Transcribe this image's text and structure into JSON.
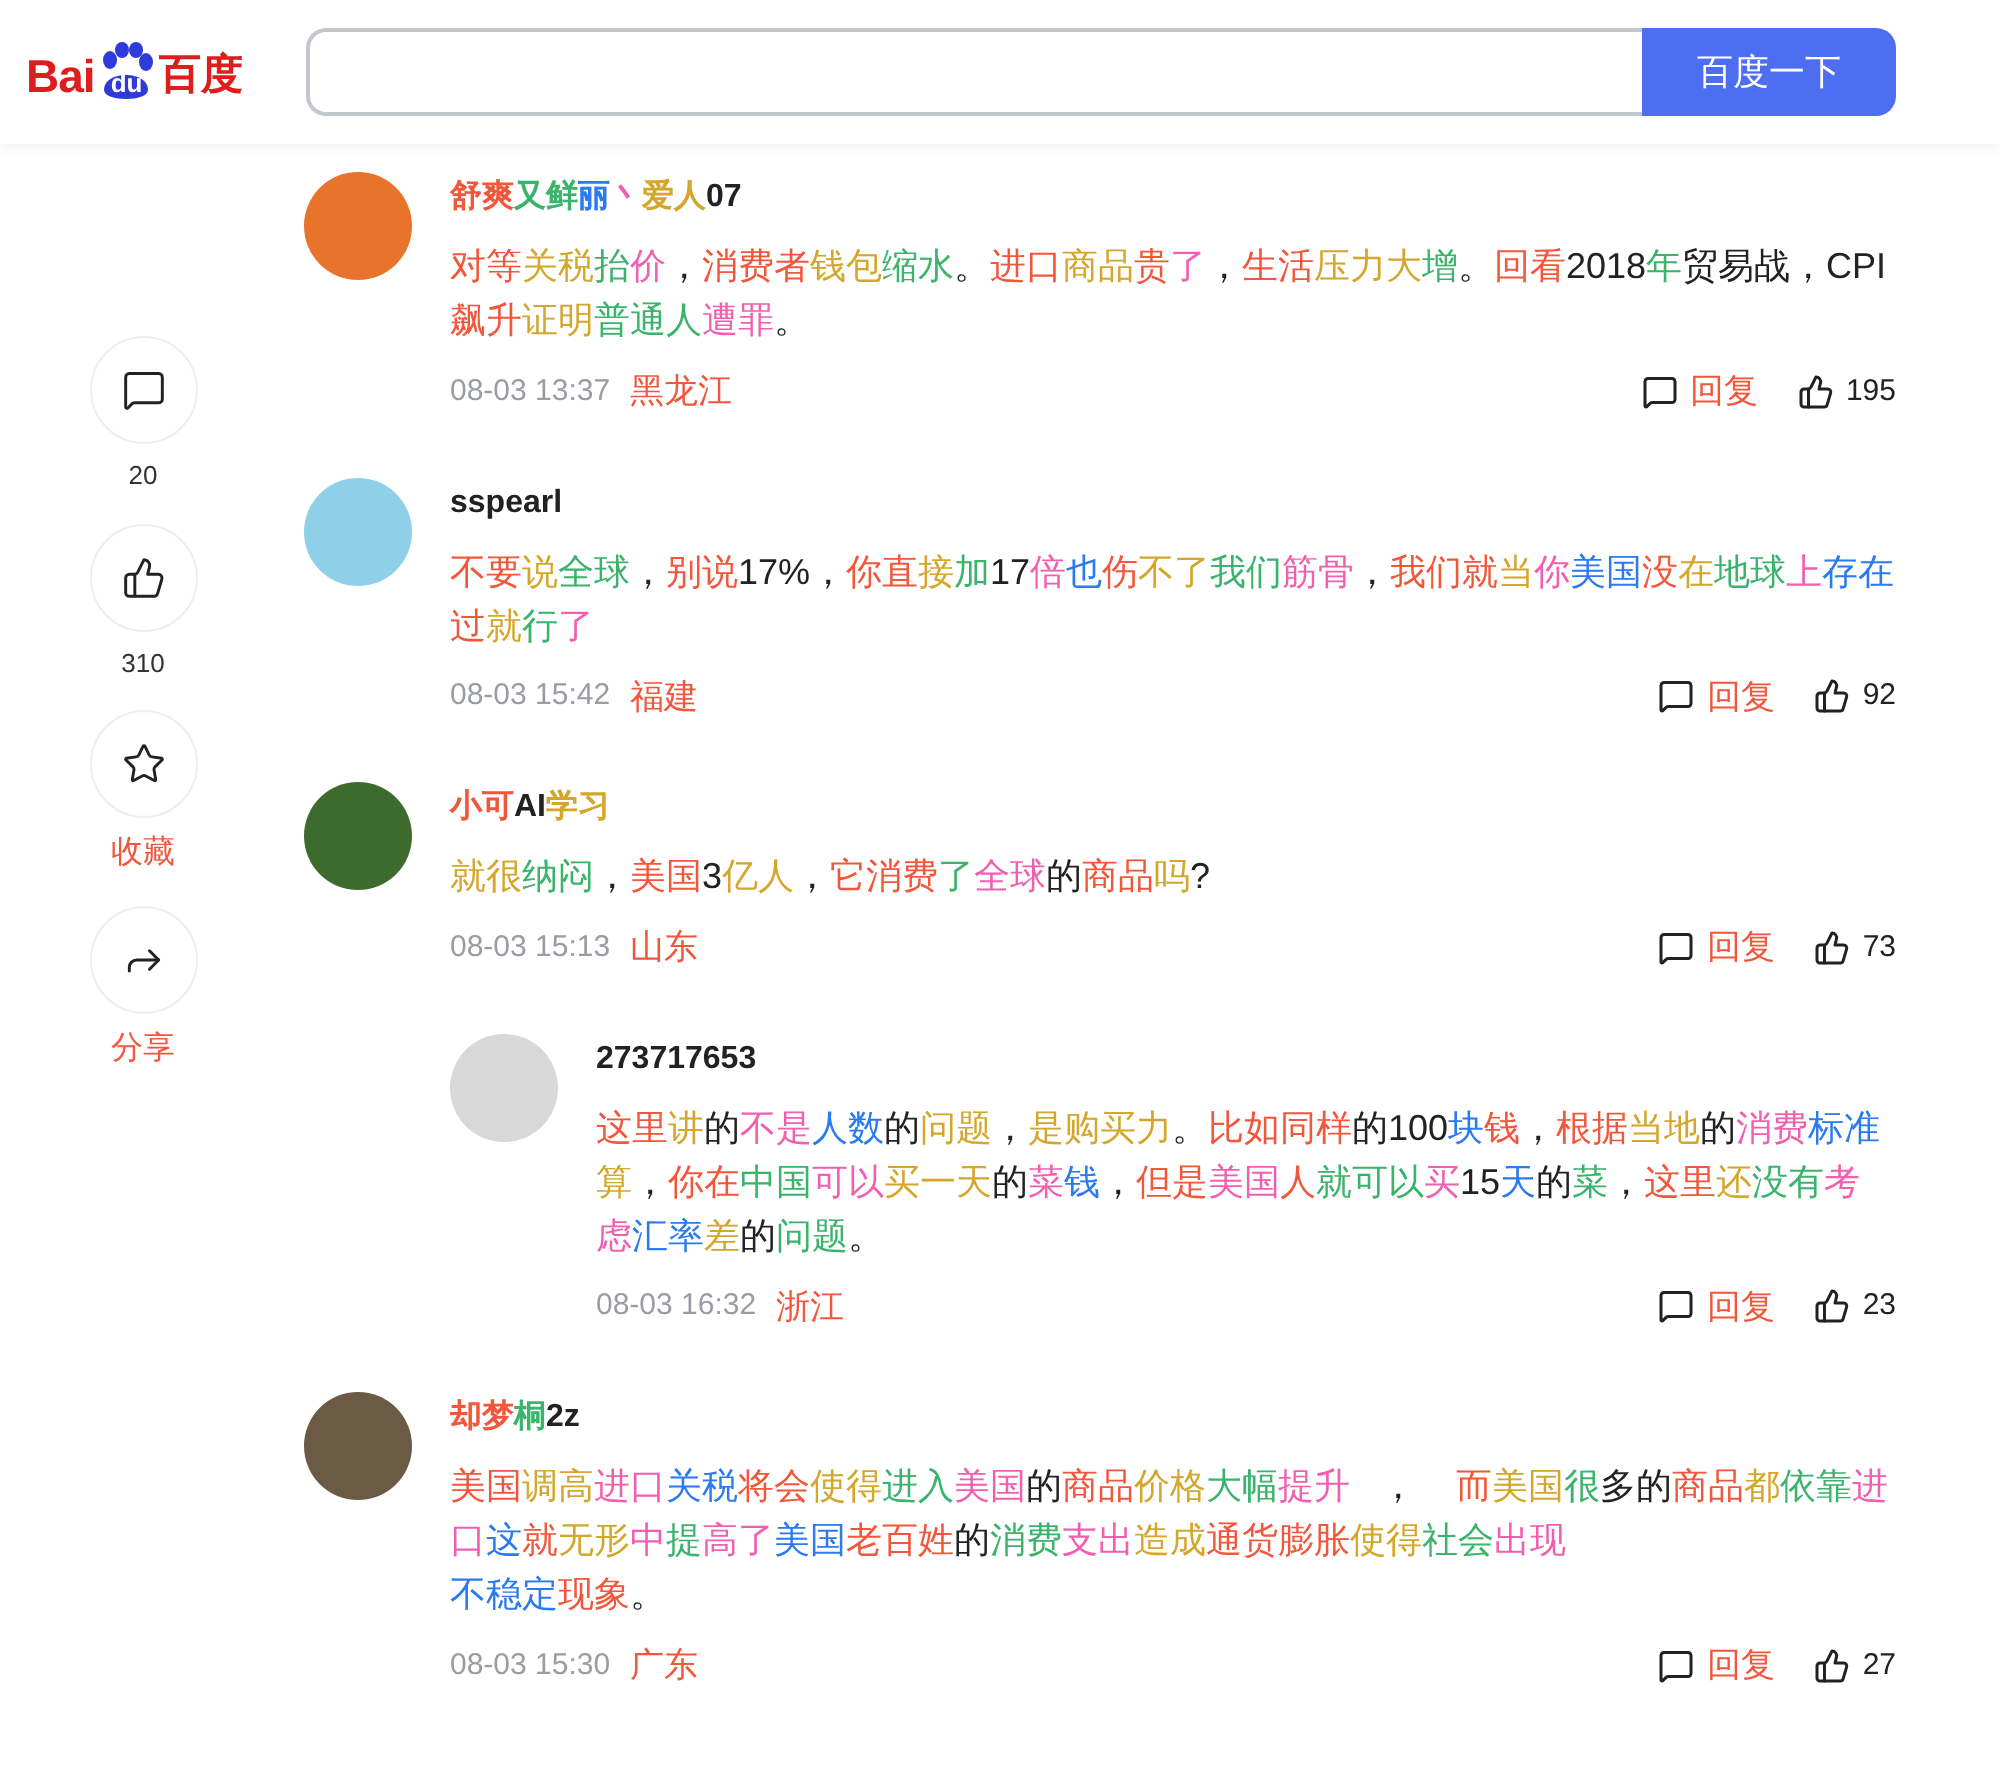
{
  "logo": {
    "left": "Bai",
    "paw": "du",
    "right": "百度"
  },
  "search": {
    "button": "百度一下"
  },
  "sidebar": [
    {
      "kind": "comment",
      "label": "20"
    },
    {
      "kind": "like",
      "label": "310"
    },
    {
      "kind": "star",
      "label": "收藏"
    },
    {
      "kind": "share",
      "label": "分享"
    }
  ],
  "comments": [
    {
      "user": [
        {
          "text": "舒爽",
          "color": "#f2573c"
        },
        {
          "text": "又鲜",
          "color": "#3ab36b"
        },
        {
          "text": "丽",
          "color": "#2b7bf0"
        },
        {
          "text": "丶",
          "color": "#f25fb0"
        },
        {
          "text": "爱人",
          "color": "#d4a72c"
        },
        {
          "text": "07",
          "color": "#222222"
        }
      ],
      "text": [
        {
          "text": "对等",
          "color": "#f2573c"
        },
        {
          "text": "关税",
          "color": "#d4a72c"
        },
        {
          "text": "抬",
          "color": "#3ab36b"
        },
        {
          "text": "价",
          "color": "#f25fb0"
        },
        {
          "text": "，",
          "color": "#222222"
        },
        {
          "text": "消费者",
          "color": "#f2573c"
        },
        {
          "text": "钱包",
          "color": "#d4a72c"
        },
        {
          "text": "缩水",
          "color": "#3ab36b"
        },
        {
          "text": "。",
          "color": "#222222"
        },
        {
          "text": "进口",
          "color": "#f2573c"
        },
        {
          "text": "商品",
          "color": "#d4a72c"
        },
        {
          "text": "贵",
          "color": "#f2573c"
        },
        {
          "text": "了",
          "color": "#f25fb0"
        },
        {
          "text": "，",
          "color": "#222222"
        },
        {
          "text": "生活",
          "color": "#f2573c"
        },
        {
          "text": "压力大",
          "color": "#d4a72c"
        },
        {
          "text": "增",
          "color": "#3ab36b"
        },
        {
          "text": "。",
          "color": "#222222"
        },
        {
          "text": "回看",
          "color": "#f2573c"
        },
        {
          "text": "2018",
          "color": "#222222"
        },
        {
          "text": "年",
          "color": "#3ab36b"
        },
        {
          "text": "贸易战，CPI",
          "color": "#222222"
        },
        {
          "text": "飙升",
          "color": "#f2573c"
        },
        {
          "text": "证明",
          "color": "#d4a72c"
        },
        {
          "text": "普通人",
          "color": "#3ab36b"
        },
        {
          "text": "遭罪",
          "color": "#f25fb0"
        },
        {
          "text": "。",
          "color": "#222222"
        }
      ],
      "time": "08-03 13:37",
      "location": "黑龙江",
      "reply": "回复",
      "likes": "195"
    },
    {
      "user": [
        {
          "text": "sspearl",
          "color": "#222222"
        }
      ],
      "text": [
        {
          "text": "不要",
          "color": "#f2573c"
        },
        {
          "text": "说",
          "color": "#d4a72c"
        },
        {
          "text": "全球",
          "color": "#3ab36b"
        },
        {
          "text": "，",
          "color": "#222222"
        },
        {
          "text": "别说",
          "color": "#f2573c"
        },
        {
          "text": "17%，",
          "color": "#222222"
        },
        {
          "text": "你直",
          "color": "#f2573c"
        },
        {
          "text": "接",
          "color": "#d4a72c"
        },
        {
          "text": "加",
          "color": "#3ab36b"
        },
        {
          "text": "17",
          "color": "#222222"
        },
        {
          "text": "倍",
          "color": "#f25fb0"
        },
        {
          "text": "也",
          "color": "#2b7bf0"
        },
        {
          "text": "伤",
          "color": "#f2573c"
        },
        {
          "text": "不了",
          "color": "#d4a72c"
        },
        {
          "text": "我们",
          "color": "#3ab36b"
        },
        {
          "text": "筋骨",
          "color": "#f25fb0"
        },
        {
          "text": "，",
          "color": "#222222"
        },
        {
          "text": "我们就",
          "color": "#f2573c"
        },
        {
          "text": "当",
          "color": "#d4a72c"
        },
        {
          "text": "你",
          "color": "#f25fb0"
        },
        {
          "text": "美国",
          "color": "#2b7bf0"
        },
        {
          "text": "没",
          "color": "#f2573c"
        },
        {
          "text": "在",
          "color": "#d4a72c"
        },
        {
          "text": "地球",
          "color": "#3ab36b"
        },
        {
          "text": "上",
          "color": "#f25fb0"
        },
        {
          "text": "存在",
          "color": "#2b7bf0"
        },
        {
          "text": "过",
          "color": "#f2573c"
        },
        {
          "text": "就",
          "color": "#d4a72c"
        },
        {
          "text": "行",
          "color": "#3ab36b"
        },
        {
          "text": "了",
          "color": "#f25fb0"
        }
      ],
      "time": "08-03 15:42",
      "location": "福建",
      "reply": "回复",
      "likes": "92"
    },
    {
      "user": [
        {
          "text": "小可",
          "color": "#f2573c"
        },
        {
          "text": "AI",
          "color": "#222222"
        },
        {
          "text": "学习",
          "color": "#d4a72c"
        }
      ],
      "text": [
        {
          "text": "就很",
          "color": "#d4a72c"
        },
        {
          "text": "纳闷",
          "color": "#3ab36b"
        },
        {
          "text": "，",
          "color": "#222222"
        },
        {
          "text": "美国",
          "color": "#f2573c"
        },
        {
          "text": "3",
          "color": "#222222"
        },
        {
          "text": "亿人",
          "color": "#d4a72c"
        },
        {
          "text": "，",
          "color": "#222222"
        },
        {
          "text": "它消费",
          "color": "#f2573c"
        },
        {
          "text": "了",
          "color": "#3ab36b"
        },
        {
          "text": "全球",
          "color": "#f25fb0"
        },
        {
          "text": "的",
          "color": "#222222"
        },
        {
          "text": "商品",
          "color": "#f2573c"
        },
        {
          "text": "吗",
          "color": "#d4a72c"
        },
        {
          "text": "?",
          "color": "#222222"
        }
      ],
      "time": "08-03 15:13",
      "location": "山东",
      "reply": "回复",
      "likes": "73",
      "replies": [
        {
          "user": [
            {
              "text": "273717653",
              "color": "#222222"
            }
          ],
          "text": [
            {
              "text": "这里",
              "color": "#f2573c"
            },
            {
              "text": "讲",
              "color": "#d4a72c"
            },
            {
              "text": "的",
              "color": "#222222"
            },
            {
              "text": "不是",
              "color": "#f25fb0"
            },
            {
              "text": "人数",
              "color": "#2b7bf0"
            },
            {
              "text": "的",
              "color": "#222222"
            },
            {
              "text": "问题",
              "color": "#d4a72c"
            },
            {
              "text": "，",
              "color": "#222222"
            },
            {
              "text": "是购买力",
              "color": "#d4a72c"
            },
            {
              "text": "。",
              "color": "#222222"
            },
            {
              "text": "比如同样",
              "color": "#f2573c"
            },
            {
              "text": "的100",
              "color": "#222222"
            },
            {
              "text": "块",
              "color": "#2b7bf0"
            },
            {
              "text": "钱",
              "color": "#f2573c"
            },
            {
              "text": "，",
              "color": "#222222"
            },
            {
              "text": "根据",
              "color": "#f2573c"
            },
            {
              "text": "当地",
              "color": "#d4a72c"
            },
            {
              "text": "的",
              "color": "#222222"
            },
            {
              "text": "消费",
              "color": "#f25fb0"
            },
            {
              "text": "标准",
              "color": "#2b7bf0"
            },
            {
              "text": "算",
              "color": "#d4a72c"
            },
            {
              "text": "，",
              "color": "#222222"
            },
            {
              "text": "你在",
              "color": "#f2573c"
            },
            {
              "text": "中国",
              "color": "#3ab36b"
            },
            {
              "text": "可以",
              "color": "#f25fb0"
            },
            {
              "text": "买一天",
              "color": "#d4a72c"
            },
            {
              "text": "的",
              "color": "#222222"
            },
            {
              "text": "菜",
              "color": "#f25fb0"
            },
            {
              "text": "钱",
              "color": "#2b7bf0"
            },
            {
              "text": "，",
              "color": "#222222"
            },
            {
              "text": "但是",
              "color": "#f2573c"
            },
            {
              "text": "美国",
              "color": "#f25fb0"
            },
            {
              "text": "人",
              "color": "#f2573c"
            },
            {
              "text": "就可以",
              "color": "#3ab36b"
            },
            {
              "text": "买",
              "color": "#f25fb0"
            },
            {
              "text": "15",
              "color": "#222222"
            },
            {
              "text": "天",
              "color": "#2b7bf0"
            },
            {
              "text": "的",
              "color": "#222222"
            },
            {
              "text": "菜",
              "color": "#3ab36b"
            },
            {
              "text": "，",
              "color": "#222222"
            },
            {
              "text": "这里",
              "color": "#f2573c"
            },
            {
              "text": "还",
              "color": "#d4a72c"
            },
            {
              "text": "没有",
              "color": "#3ab36b"
            },
            {
              "text": "考虑",
              "color": "#f25fb0"
            },
            {
              "text": "汇率",
              "color": "#2b7bf0"
            },
            {
              "text": "差",
              "color": "#d4a72c"
            },
            {
              "text": "的",
              "color": "#222222"
            },
            {
              "text": "问题",
              "color": "#3ab36b"
            },
            {
              "text": "。",
              "color": "#222222"
            }
          ],
          "time": "08-03 16:32",
          "location": "浙江",
          "reply": "回复",
          "likes": "23"
        }
      ]
    },
    {
      "user": [
        {
          "text": "却梦",
          "color": "#f2573c"
        },
        {
          "text": "桐",
          "color": "#3ab36b"
        },
        {
          "text": "2z",
          "color": "#222222"
        }
      ],
      "text": [
        {
          "text": "美国",
          "color": "#f2573c"
        },
        {
          "text": "调高",
          "color": "#d4a72c"
        },
        {
          "text": "进口",
          "color": "#f25fb0"
        },
        {
          "text": "关税",
          "color": "#2b7bf0"
        },
        {
          "text": "将会",
          "color": "#f2573c"
        },
        {
          "text": "使得",
          "color": "#d4a72c"
        },
        {
          "text": "进入",
          "color": "#3ab36b"
        },
        {
          "text": "美国",
          "color": "#f25fb0"
        },
        {
          "text": "的",
          "color": "#222222"
        },
        {
          "text": "商品",
          "color": "#f2573c"
        },
        {
          "text": "价格",
          "color": "#d4a72c"
        },
        {
          "text": "大幅",
          "color": "#3ab36b"
        },
        {
          "text": "提升",
          "color": "#f25fb0"
        },
        {
          "text": "   ，    ",
          "color": "#222222"
        },
        {
          "text": "而",
          "color": "#f2573c"
        },
        {
          "text": "美国",
          "color": "#d4a72c"
        },
        {
          "text": "很",
          "color": "#3ab36b"
        },
        {
          "text": "多的",
          "color": "#222222"
        },
        {
          "text": "商品",
          "color": "#f2573c"
        },
        {
          "text": "都",
          "color": "#d4a72c"
        },
        {
          "text": "依靠",
          "color": "#3ab36b"
        },
        {
          "text": "进口",
          "color": "#f25fb0"
        },
        {
          "text": "这",
          "color": "#2b7bf0"
        },
        {
          "text": "就",
          "color": "#f2573c"
        },
        {
          "text": "无形",
          "color": "#d4a72c"
        },
        {
          "text": "中",
          "color": "#f25fb0"
        },
        {
          "text": "提",
          "color": "#3ab36b"
        },
        {
          "text": "高了",
          "color": "#f25fb0"
        },
        {
          "text": "美国",
          "color": "#2b7bf0"
        },
        {
          "text": "老百姓",
          "color": "#f2573c"
        },
        {
          "text": "的",
          "color": "#222222"
        },
        {
          "text": "消费",
          "color": "#3ab36b"
        },
        {
          "text": "支出",
          "color": "#f25fb0"
        },
        {
          "text": "造成",
          "color": "#d4a72c"
        },
        {
          "text": "通货膨胀",
          "color": "#f2573c"
        },
        {
          "text": "使得",
          "color": "#d4a72c"
        },
        {
          "text": "社会",
          "color": "#3ab36b"
        },
        {
          "text": "出现",
          "color": "#f25fb0"
        },
        {
          "text": "\n不稳定",
          "color": "#2b7bf0"
        },
        {
          "text": "现象",
          "color": "#f2573c"
        },
        {
          "text": "。",
          "color": "#222222"
        }
      ],
      "time": "08-03 15:30",
      "location": "广东",
      "reply": "回复",
      "likes": "27"
    }
  ]
}
